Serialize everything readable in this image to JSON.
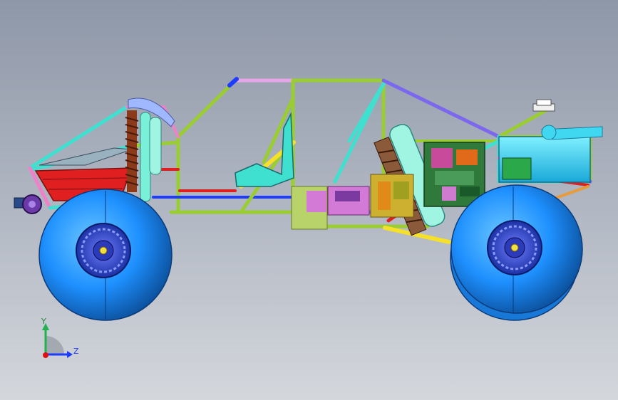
{
  "viewport": {
    "model": "buggy-assembly",
    "view": "side-orthographic"
  },
  "triad": {
    "y_label": "Y",
    "z_label": "Z",
    "colors": {
      "y": "#22b14c",
      "z": "#1e3cff",
      "x": "#e01010"
    }
  },
  "colors": {
    "tire": "#1e90ff",
    "rim": "#1434b4",
    "tube_green": "#9acd32",
    "tube_cyan": "#40e0d0",
    "tube_purple": "#7b68ee",
    "tank_red": "#e02020",
    "spring": "#8b3a1a"
  }
}
